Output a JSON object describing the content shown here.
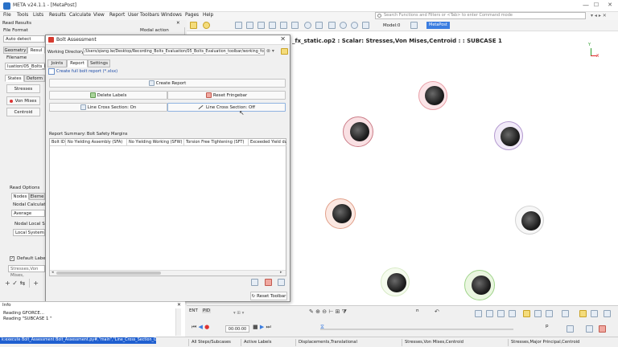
{
  "window": {
    "title": "META v24.1.1 - [MetaPost]",
    "minimize": "—",
    "maximize": "☐",
    "close": "✕"
  },
  "menu": [
    "File",
    "Tools",
    "Lists",
    "Results",
    "Calculate",
    "View",
    "Report",
    "User Toolbars",
    "Windows",
    "Pages",
    "Help"
  ],
  "search": {
    "placeholder": "Search Functions and Filters or <Tab> to enter Command mode"
  },
  "left_panel": {
    "read_results": "Read Results",
    "close_icon": "✕",
    "modal_action": "Modal action",
    "file_format_label": "File Format",
    "file_format_value": "Auto detect",
    "tabs": [
      "Geometry",
      "Resul"
    ],
    "filename_label": "Filename",
    "filename_value": "luation/05_Bolts_Evalu",
    "sub_tabs": [
      "States",
      "Deform"
    ],
    "buttons": [
      "Stresses",
      "Von Mises",
      "Centroid"
    ],
    "read_options": "Read Options",
    "nodes_tabs": [
      "Nodes",
      "Eleme"
    ],
    "nodal_calc_label": "Nodal Calculation",
    "nodal_calc_value": "Average",
    "nodal_local_label": "Nodal Local Syst",
    "nodal_local_value": "Local System",
    "default_label": "Default Label",
    "label_value": "Stresses,Von Mises,"
  },
  "toolbar": {
    "model_label": "Model:0",
    "metapost_badge": "MetaPost"
  },
  "viewport": {
    "title": "_fx_static.op2 : Scalar: Stresses,Von Mises,Centroid : : SUBCASE 1",
    "axis_y": "Y",
    "axis_x": "X"
  },
  "dialog": {
    "title": "Bolt Assessment",
    "close": "✕",
    "working_dir_label": "Working Directory:",
    "working_dir_value": "/Users/qiang.lw/Desktop/Recording_Bolts_Evaluation/05_Bolts_Evaluation_toolbar/working_folder/",
    "tabs": [
      "Joints",
      "Report",
      "Settings"
    ],
    "create_full_report": "Create full bolt report (*.xlsx)",
    "create_report": "Create Report",
    "delete_labels": "Delete Labels",
    "reset_fringebar": "Reset Fringebar",
    "line_cross_on": "Line Cross Section: On",
    "line_cross_off": "Line Cross Section: Off",
    "report_summary": "Report Summary: Bolt Safety Margins",
    "columns": [
      "Bolt ID",
      "No Yielding Assembly (SFA)",
      "No Yielding Working (SFW)",
      "Torsion Free Tightening (SFT)",
      "Exceeded Yield durin"
    ],
    "reset_toolbar": "Reset Toolbar"
  },
  "info_panel": {
    "title": "Info",
    "close": "✕",
    "lines": [
      "Reading GFORCE...",
      "Reading \"SUBCASE 1          \""
    ]
  },
  "bottom": {
    "command": "k:execute Bolt_Assessment Bolt_Assessment.py#,\"main\",\"Line_Cross_Section_On\")",
    "time": "00:00:00",
    "steps": "All Steps/Subcases",
    "labels": "Active Labels",
    "displacements": "Displacements,Translational",
    "stresses_vm": "Stresses,Von Mises,Centroid",
    "stresses_mp": "Stresses,Major Principal,Centroid",
    "ent": "ENT",
    "pid": "PID",
    "n_label": "n",
    "p_label": "p"
  },
  "colors": {
    "accent_blue": "#1f5fd0",
    "ring_red": "#e9a0a8",
    "ring_orange": "#e2a08a",
    "ring_purple": "#b49ad0",
    "ring_green": "#b6e0a0"
  }
}
